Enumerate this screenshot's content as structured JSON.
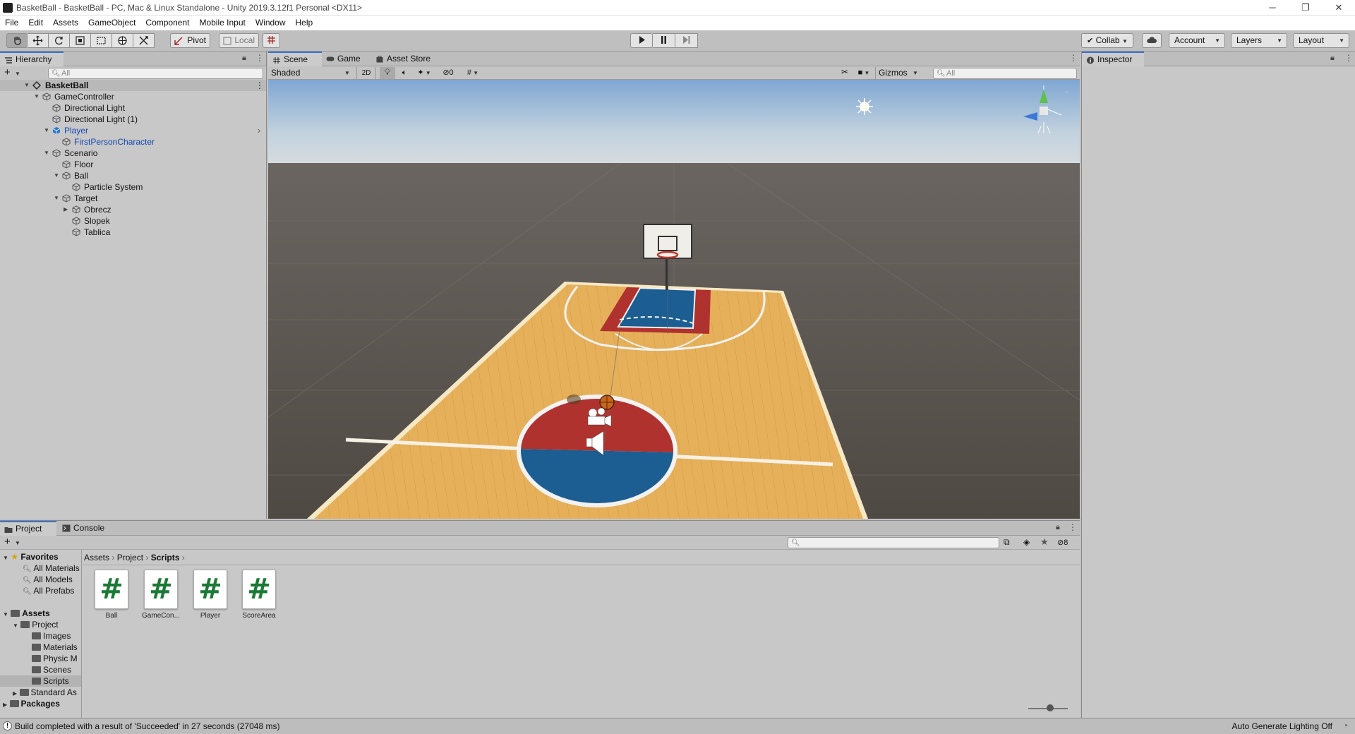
{
  "window": {
    "title": "BasketBall - BasketBall - PC, Mac & Linux Standalone - Unity 2019.3.12f1 Personal <DX11>",
    "minimize": "─",
    "maximize": "❐",
    "close": "✕"
  },
  "menu": [
    "File",
    "Edit",
    "Assets",
    "GameObject",
    "Component",
    "Mobile Input",
    "Window",
    "Help"
  ],
  "toolbar": {
    "pivot_label": "Pivot",
    "local_label": "Local",
    "collab_label": "Collab",
    "account_label": "Account",
    "layers_label": "Layers",
    "layout_label": "Layout"
  },
  "hierarchy": {
    "tab_label": "Hierarchy",
    "search_placeholder": "All",
    "scene_name": "BasketBall",
    "items": [
      {
        "label": "GameController",
        "blue": false
      },
      {
        "label": "Directional Light",
        "blue": false
      },
      {
        "label": "Directional Light (1)",
        "blue": false
      },
      {
        "label": "Player",
        "blue": true
      },
      {
        "label": "FirstPersonCharacter",
        "blue": true
      },
      {
        "label": "Scenario",
        "blue": false
      },
      {
        "label": "Floor",
        "blue": false
      },
      {
        "label": "Ball",
        "blue": false
      },
      {
        "label": "Particle System",
        "blue": false
      },
      {
        "label": "Target",
        "blue": false
      },
      {
        "label": "Obrecz",
        "blue": false
      },
      {
        "label": "Slopek",
        "blue": false
      },
      {
        "label": "Tablica",
        "blue": false
      }
    ]
  },
  "scene": {
    "tabs": [
      "Scene",
      "Game",
      "Asset Store"
    ],
    "shading_mode": "Shaded",
    "two_d_label": "2D",
    "hidden_count": "0",
    "gizmos_label": "Gizmos",
    "search_placeholder": "All"
  },
  "inspector": {
    "tab_label": "Inspector"
  },
  "project": {
    "tabs": [
      "Project",
      "Console"
    ],
    "hidden_count": "8",
    "favorites_label": "Favorites",
    "favorites": [
      "All Materials",
      "All Models",
      "All Prefabs"
    ],
    "assets_label": "Assets",
    "tree": [
      "Project",
      "Images",
      "Materials",
      "Physic M",
      "Scenes",
      "Scripts",
      "Standard As"
    ],
    "packages_label": "Packages",
    "breadcrumb": [
      "Assets",
      "Project",
      "Scripts"
    ],
    "files": [
      "Ball",
      "GameCon...",
      "Player",
      "ScoreArea"
    ]
  },
  "status": {
    "message": "Build completed with a result of 'Succeeded' in 27 seconds (27048 ms)",
    "lighting": "Auto Generate Lighting Off"
  },
  "colors": {
    "accent": "#3a72c9",
    "prefab_blue": "#1546b3",
    "court_wood": "#e8b45c",
    "court_red": "#b0322e",
    "court_blue": "#1c5d92",
    "script_green": "#1a7a35"
  }
}
